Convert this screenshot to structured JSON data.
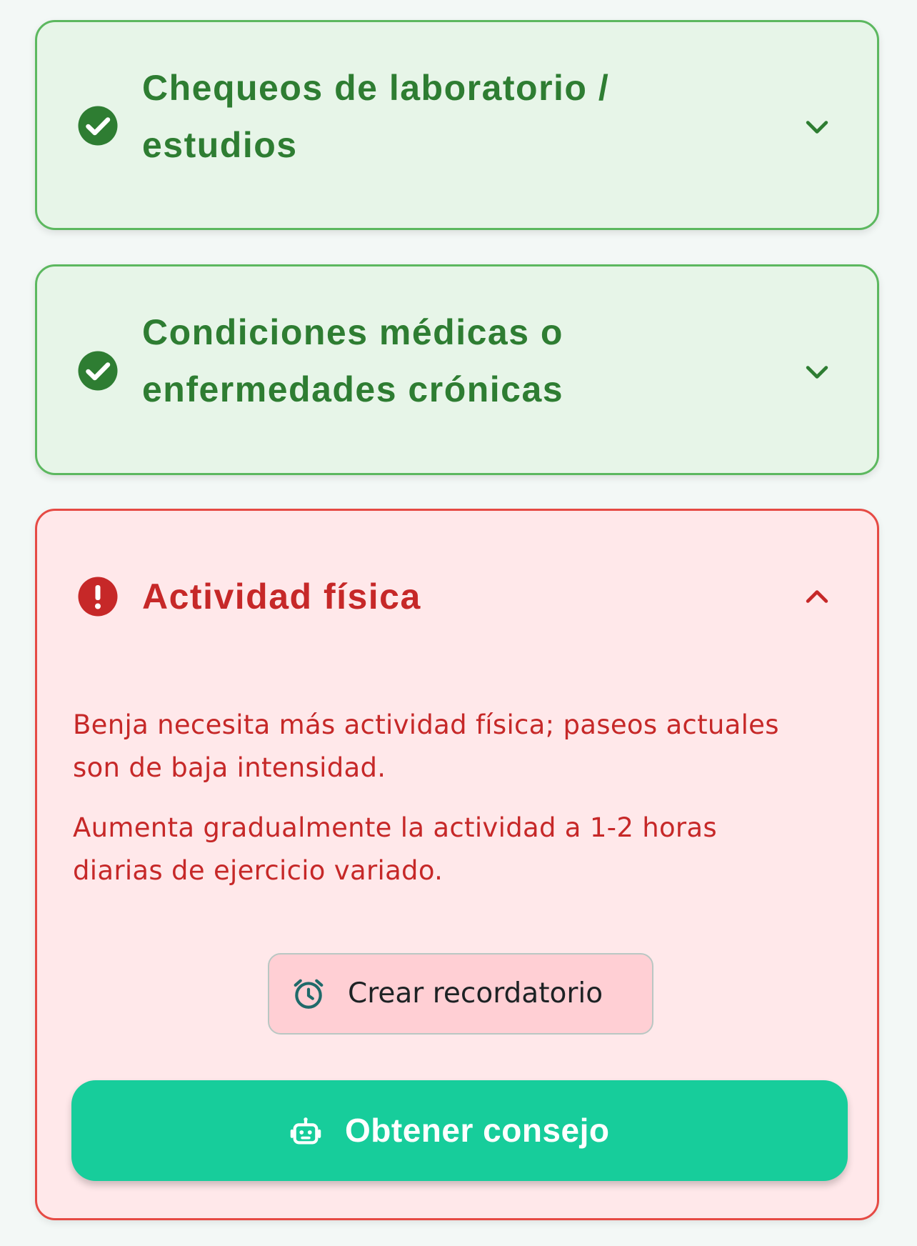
{
  "sections": [
    {
      "title_line1": "Chequeos de laboratorio /",
      "title_line2": "estudios",
      "status": "completed",
      "status_icon": "check-circle-icon",
      "chevron": "chevron-down-icon",
      "expanded": false
    },
    {
      "title_line1": "Condiciones médicas o",
      "title_line2": "enfermedades crónicas",
      "status": "completed",
      "status_icon": "check-circle-icon",
      "chevron": "chevron-down-icon",
      "expanded": false
    },
    {
      "title": "Actividad física",
      "status": "warning",
      "status_icon": "alert-circle-icon",
      "chevron": "chevron-up-icon",
      "expanded": true,
      "finding_line1": "Benja necesita más actividad física; paseos actuales",
      "finding_line2": "son de baja intensidad.",
      "recommendation_line1": "Aumenta gradualmente la actividad a 1-2 horas",
      "recommendation_line2": "diarias de ejercicio variado.",
      "reminder_button": {
        "label": "Crear recordatorio",
        "icon": "alarm-clock-icon"
      },
      "advice_button": {
        "label": "Obtener consejo",
        "icon": "robot-icon"
      }
    }
  ],
  "colors": {
    "ok_text": "#2e7d32",
    "ok_border": "#5cb85f",
    "ok_background": "#e7f5e8",
    "warn_text": "#c62828",
    "warn_border": "#e64a44",
    "warn_background": "#ffe8ea",
    "accent_button": "#17cd9b",
    "reminder_button_bg": "#ffcfd4"
  }
}
